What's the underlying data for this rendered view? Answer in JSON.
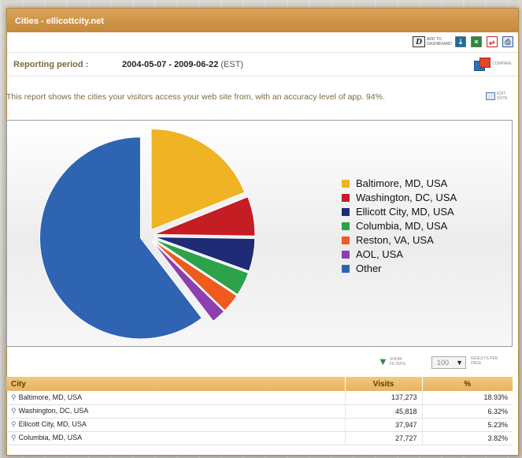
{
  "window": {
    "title": "Cities - ellicottcity.net"
  },
  "toolbar": {
    "dashboard_label": "ADD TO DASHBOARD",
    "dashboard_icon": "D",
    "icons": [
      "csv-icon",
      "excel-icon",
      "pdf-icon",
      "print-icon"
    ]
  },
  "period": {
    "label": "Reporting period :",
    "range": "2004-05-07 - 2009-06-22",
    "tz": "(EST)"
  },
  "compare": {
    "label": "COMPARE"
  },
  "description": "This report shows the cities your visitors access your web site from, with an accuracy level of app. 94%.",
  "edit_note": {
    "label": "EDIT NOTE"
  },
  "chart_data": {
    "type": "pie",
    "title": "",
    "legend_position": "right",
    "slices": [
      {
        "label": "Baltimore, MD, USA",
        "value": 18.93,
        "color": "#f0b323"
      },
      {
        "label": "Washington, DC, USA",
        "value": 6.32,
        "color": "#c41d23"
      },
      {
        "label": "Ellicott City, MD, USA",
        "value": 5.23,
        "color": "#1f2b75"
      },
      {
        "label": "Columbia, MD, USA",
        "value": 3.82,
        "color": "#2ca24a"
      },
      {
        "label": "Reston, VA, USA",
        "value": 3.0,
        "color": "#ef5a1e"
      },
      {
        "label": "AOL, USA",
        "value": 2.3,
        "color": "#8d3fb2"
      },
      {
        "label": "Other",
        "value": 60.4,
        "color": "#2f64b3"
      }
    ]
  },
  "filters": {
    "show_label": "SHOW FILTERS"
  },
  "pagination": {
    "results_per_page": "100",
    "results_label": "RESULTS PER PAGE"
  },
  "table": {
    "columns": [
      "City",
      "Visits",
      "%"
    ],
    "rows": [
      {
        "city": "Baltimore, MD, USA",
        "visits": "137,273",
        "pct": "18.93%"
      },
      {
        "city": "Washington, DC, USA",
        "visits": "45,818",
        "pct": "6.32%"
      },
      {
        "city": "Ellicott City, MD, USA",
        "visits": "37,947",
        "pct": "5.23%"
      },
      {
        "city": "Columbia, MD, USA",
        "visits": "27,727",
        "pct": "3.82%"
      }
    ]
  }
}
